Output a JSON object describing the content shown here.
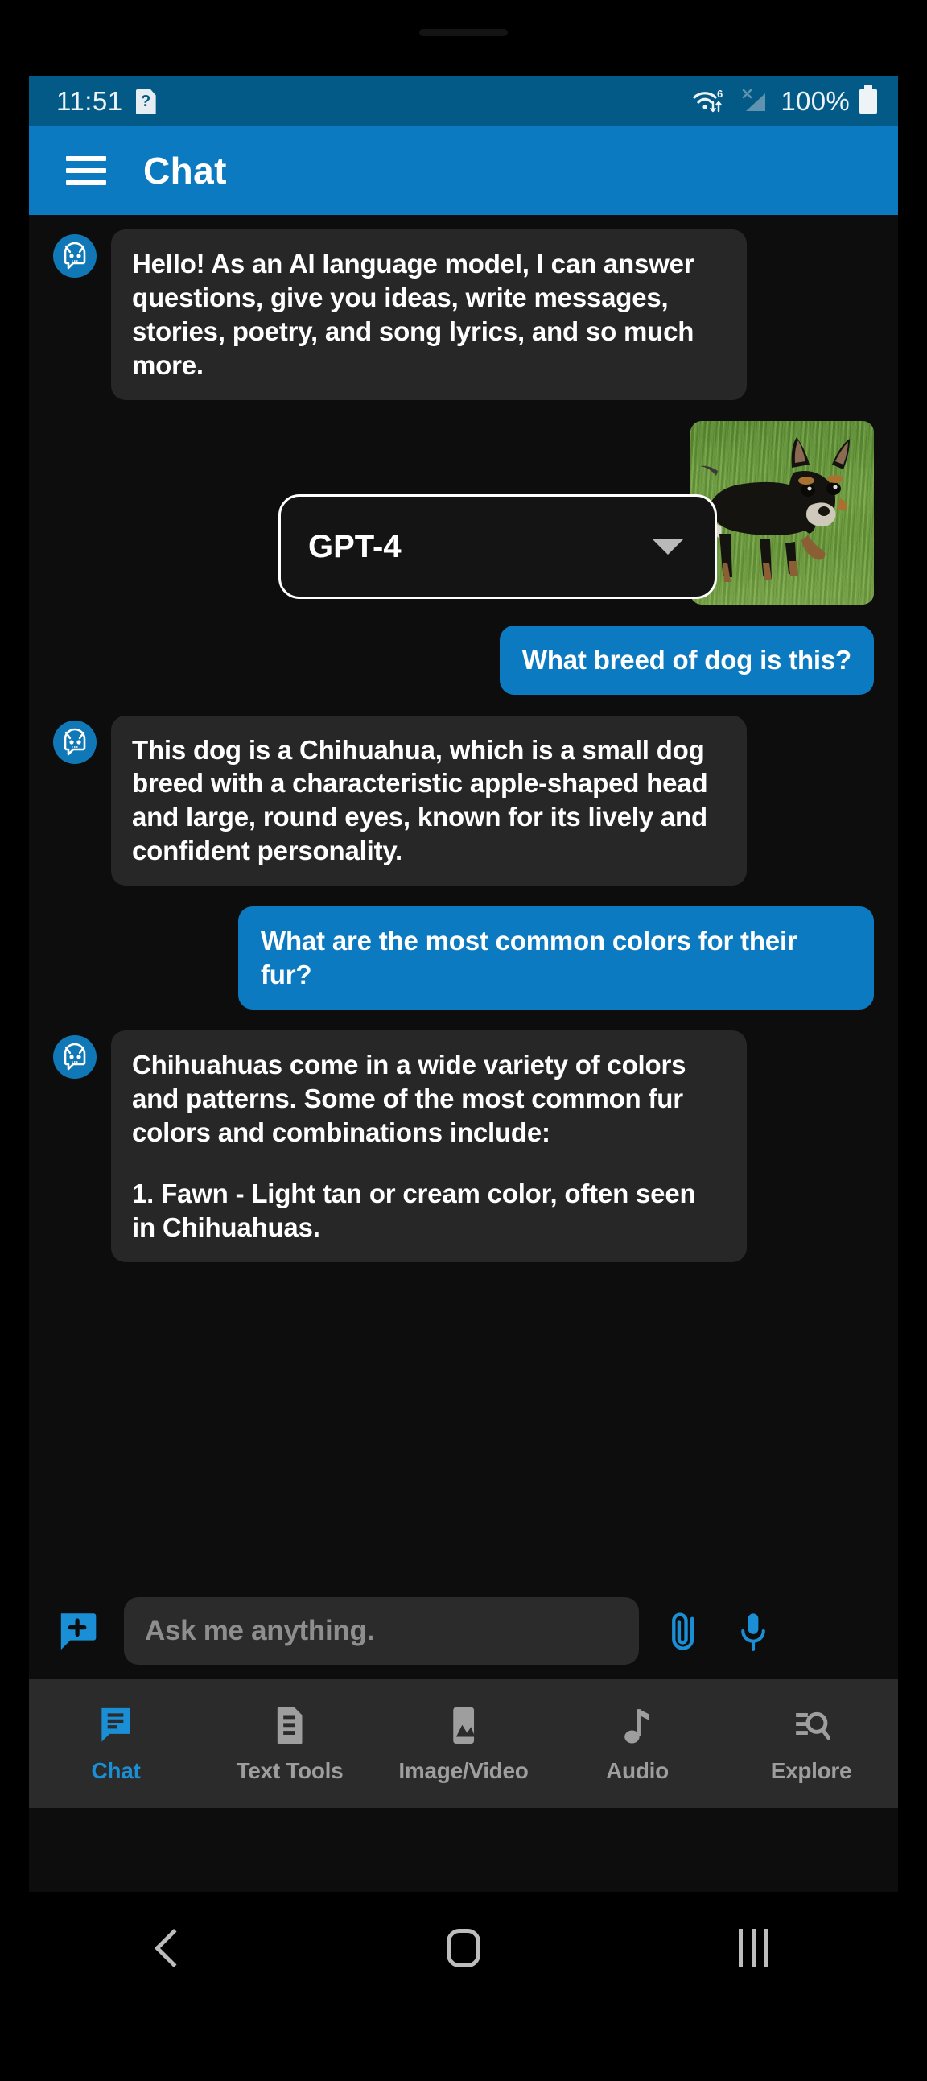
{
  "status_bar": {
    "time": "11:51",
    "doc_icon_glyph": "?",
    "icons": [
      "wifi-6-icon",
      "no-sim-signal-icon"
    ],
    "battery_text": "100%",
    "background_color": "#035a86"
  },
  "app_bar": {
    "menu_icon": "hamburger-menu-icon",
    "title": "Chat",
    "background_color": "#0b7ac0"
  },
  "model_selector": {
    "value": "GPT-4",
    "caret_icon": "chevron-down-icon"
  },
  "chat": {
    "messages": [
      {
        "sender": "bot",
        "avatar_icon": "robot-avatar-icon",
        "text": "Hello! As an AI language model, I can answer questions, give you ideas, write messages, stories, poetry, and song lyrics, and so much more."
      },
      {
        "sender": "user",
        "type": "image",
        "image_alt": "chihuahua-photo"
      },
      {
        "sender": "user",
        "text": "What breed of dog is this?"
      },
      {
        "sender": "bot",
        "avatar_icon": "robot-avatar-icon",
        "text": "This dog is a Chihuahua, which is a small dog breed with a characteristic apple-shaped head and large, round eyes, known for its lively and confident personality."
      },
      {
        "sender": "user",
        "text": "What are the most common colors for their fur?"
      },
      {
        "sender": "bot",
        "avatar_icon": "robot-avatar-icon",
        "paragraphs": [
          "Chihuahuas come in a wide variety of colors and patterns. Some of the most common fur colors and combinations include:",
          "1. Fawn - Light tan or cream color, often seen in Chihuahuas."
        ]
      }
    ],
    "bot_bubble_color": "#272727",
    "user_bubble_color": "#0b7ac0",
    "background_color": "#0d0d0d"
  },
  "input_bar": {
    "new_chat_icon": "new-chat-bubble-plus-icon",
    "placeholder": "Ask me anything.",
    "value": "",
    "attach_icon": "paperclip-icon",
    "mic_icon": "microphone-icon",
    "accent_color": "#1b8fd6"
  },
  "bottom_nav": {
    "active_index": 0,
    "items": [
      {
        "label": "Chat",
        "icon": "chat-bubble-lines-icon"
      },
      {
        "label": "Text Tools",
        "icon": "document-lines-icon"
      },
      {
        "label": "Image/Video",
        "icon": "image-mountain-icon"
      },
      {
        "label": "Audio",
        "icon": "music-note-icon"
      },
      {
        "label": "Explore",
        "icon": "search-list-icon"
      }
    ],
    "active_color": "#1b8fd6",
    "inactive_color": "#9e9e9e"
  },
  "android_nav": {
    "back_icon": "back-chevron-icon",
    "home_icon": "home-circle-icon",
    "recents_icon": "recents-bars-icon"
  }
}
